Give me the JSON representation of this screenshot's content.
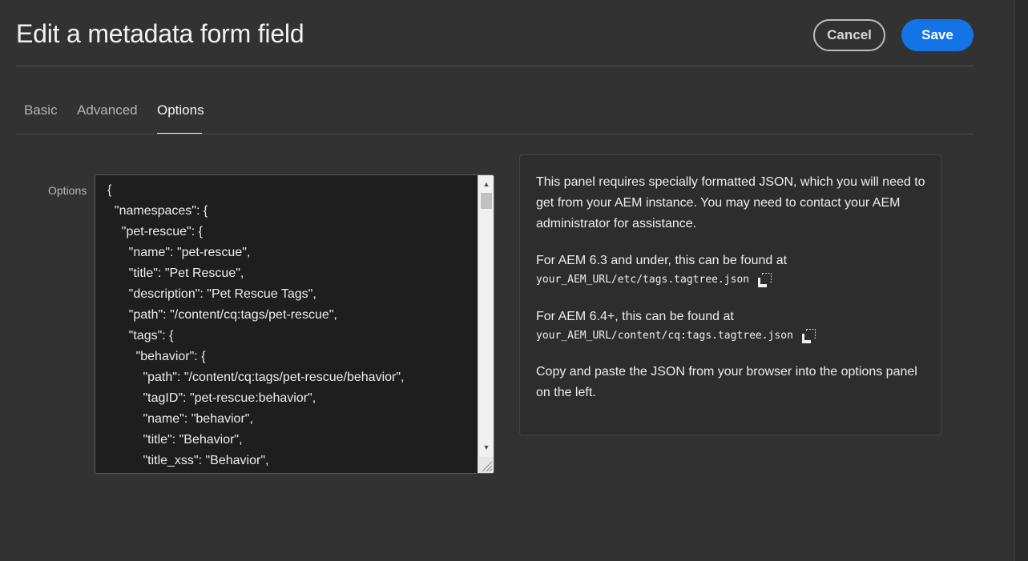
{
  "header": {
    "title": "Edit a metadata form field",
    "cancel_label": "Cancel",
    "save_label": "Save"
  },
  "tabs": [
    {
      "label": "Basic",
      "active": false
    },
    {
      "label": "Advanced",
      "active": false
    },
    {
      "label": "Options",
      "active": true
    }
  ],
  "options_field": {
    "label": "Options",
    "lines": [
      "{",
      "  \"namespaces\": {",
      "    \"pet-rescue\": {",
      "      \"name\": \"pet-rescue\",",
      "      \"title\": \"Pet Rescue\",",
      "      \"description\": \"Pet Rescue Tags\",",
      "      \"path\": \"/content/cq:tags/pet-rescue\",",
      "      \"tags\": {",
      "        \"behavior\": {",
      "          \"path\": \"/content/cq:tags/pet-rescue/behavior\",",
      "          \"tagID\": \"pet-rescue:behavior\",",
      "          \"name\": \"behavior\",",
      "          \"title\": \"Behavior\",",
      "          \"title_xss\": \"Behavior\","
    ]
  },
  "info_panel": {
    "intro": "This panel requires specially formatted JSON, which you will need to get from your AEM instance. You may need to contact your AEM administrator for assistance.",
    "aem63_text": "For AEM 6.3 and under, this can be found at",
    "aem63_url": "your_AEM_URL/etc/tags.tagtree.json",
    "aem64_text": "For AEM 6.4+, this can be found at",
    "aem64_url": "your_AEM_URL/content/cq:tags.tagtree.json",
    "outro": "Copy and paste the JSON from your browser into the options panel on the left."
  },
  "colors": {
    "background": "#323232",
    "accent": "#1473e6",
    "editor_bg": "#1e1e1e"
  }
}
